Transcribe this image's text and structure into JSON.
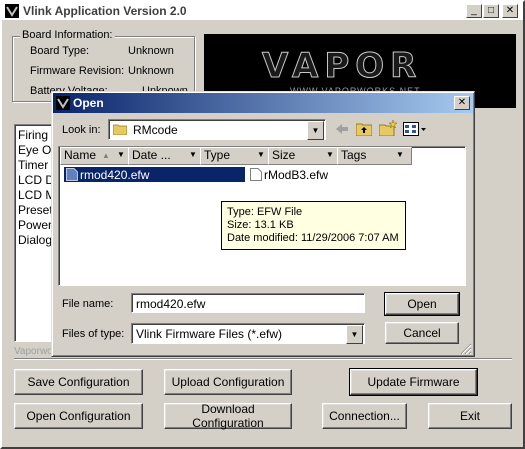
{
  "window": {
    "title": "Vlink Application Version 2.0",
    "minimize": "_",
    "maximize": "□",
    "close": "✕"
  },
  "board_info": {
    "label": "Board Information:",
    "rows": [
      {
        "key": "Board Type:",
        "value": "Unknown"
      },
      {
        "key": "Firmware Revision:",
        "value": "Unknown"
      },
      {
        "key": "Battery Voltage:",
        "value": "Unknown"
      }
    ]
  },
  "logo": {
    "text": "VAPOR",
    "sub": "WWW.VAPORWORKS.NET"
  },
  "left_list": [
    "Firing ",
    "Eye O",
    "Timer",
    "LCD D",
    "LCD M",
    "Preset",
    "Power",
    "Dialog"
  ],
  "vaporworks_label": "Vaporworks",
  "buttons": {
    "save_config": "Save Configuration",
    "upload_config": "Upload Configuration",
    "update_firmware": "Update Firmware",
    "open_config": "Open Configuration",
    "download_config": "Download Configuration",
    "connection": "Connection...",
    "exit": "Exit"
  },
  "dialog": {
    "title": "Open",
    "look_in_label": "Look in:",
    "look_in_value": "RMcode",
    "columns": [
      {
        "label": "Name",
        "sort": "▲"
      },
      {
        "label": "Date ...",
        "sort": ""
      },
      {
        "label": "Type",
        "sort": ""
      },
      {
        "label": "Size",
        "sort": ""
      },
      {
        "label": "Tags",
        "sort": ""
      }
    ],
    "files": [
      {
        "name": "rmod420.efw",
        "selected": true
      },
      {
        "name": "rModB3.efw",
        "selected": false
      }
    ],
    "tooltip": {
      "type": "Type: EFW File",
      "size": "Size: 13.1 KB",
      "modified": "Date modified: 11/29/2006 7:07 AM"
    },
    "file_name_label": "File name:",
    "file_name_value": "rmod420.efw",
    "files_of_type_label": "Files of type:",
    "files_of_type_value": "Vlink Firmware Files (*.efw)",
    "open_button": "Open",
    "cancel_button": "Cancel",
    "close": "✕"
  }
}
